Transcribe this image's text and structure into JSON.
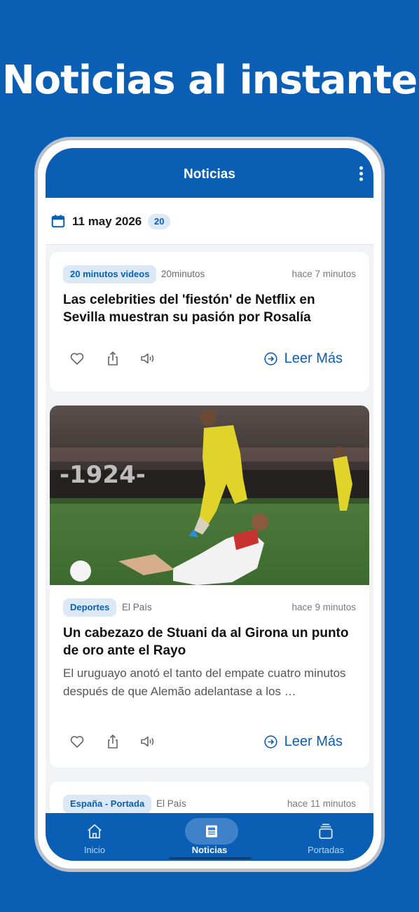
{
  "promo": {
    "headline": "Noticias al instante"
  },
  "appbar": {
    "title": "Noticias",
    "menu_icon": "more-vert-icon"
  },
  "datebar": {
    "date": "11 may 2026",
    "count": "20",
    "icon": "calendar-icon"
  },
  "articles": [
    {
      "tag": "20 minutos videos",
      "source": "20minutos",
      "time": "hace 7 minutos",
      "title": "Las celebrities del 'fiestón' de Netflix en Sevilla muestran su pasión por Rosalía",
      "read_more": "Leer Más"
    },
    {
      "tag": "Deportes",
      "source": "El País",
      "time": "hace 9 minutos",
      "title": "Un cabezazo de Stuani da al Girona un punto de oro ante el Rayo",
      "summary": "El uruguayo anotó el tanto del empate cuatro minutos después de que Alemão adelantase a los …",
      "read_more": "Leer Más",
      "banner_text": "-1924-"
    },
    {
      "tag": "España - Portada",
      "source": "El País",
      "time": "hace 11 minutos"
    }
  ],
  "bottom_nav": [
    {
      "label": "Inicio",
      "icon": "home-icon"
    },
    {
      "label": "Noticias",
      "icon": "newspaper-icon",
      "active": true
    },
    {
      "label": "Portadas",
      "icon": "stack-icon"
    }
  ],
  "colors": {
    "brand": "#0a5fb4",
    "tag_bg": "#dbe9f7"
  }
}
